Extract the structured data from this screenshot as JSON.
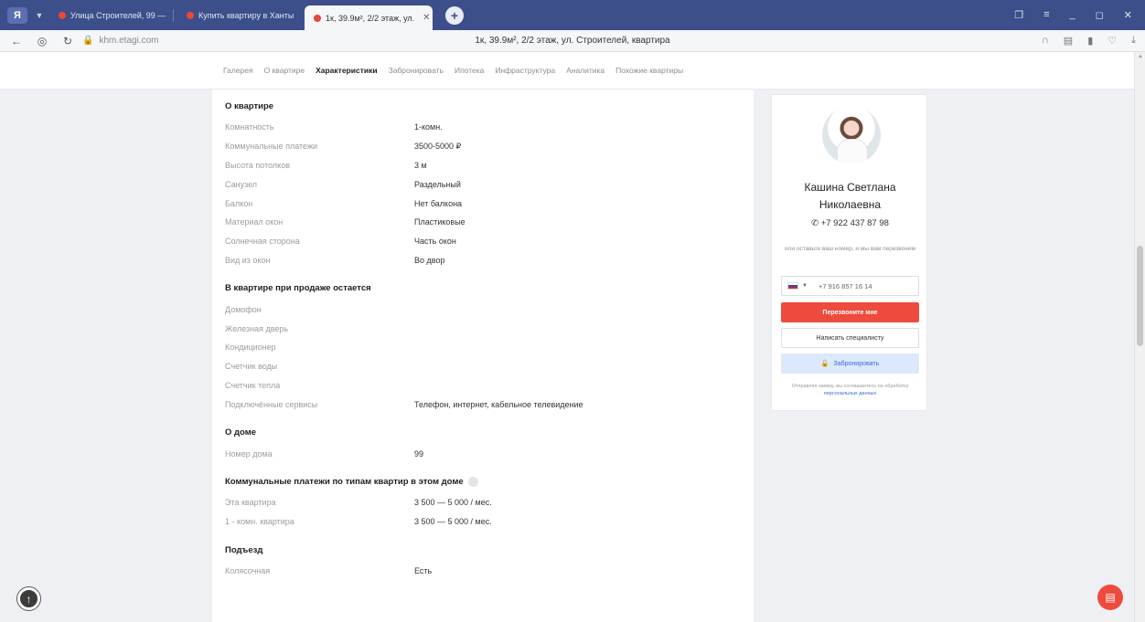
{
  "browser": {
    "tabs": [
      {
        "label": "Улица Строителей, 99 —"
      },
      {
        "label": "Купить квартиру в Ханты"
      },
      {
        "label": "1к, 39.9м², 2/2 этаж, ул."
      }
    ],
    "new_tab_icon": "+",
    "url": "khm.etagi.com",
    "page_title": "1к, 39.9м², 2/2 этаж, ул. Строителей, квартира"
  },
  "site_nav": {
    "items": [
      {
        "label": "Галерея"
      },
      {
        "label": "О квартире"
      },
      {
        "label": "Характеристики"
      },
      {
        "label": "Забронировать"
      },
      {
        "label": "Ипотека"
      },
      {
        "label": "Инфраструктура"
      },
      {
        "label": "Аналитика"
      },
      {
        "label": "Похожие квартиры"
      }
    ],
    "active_index": 2
  },
  "apartment": {
    "title": "О квартире",
    "rows": [
      {
        "k": "Комнатность",
        "v": "1-комн."
      },
      {
        "k": "Коммунальные платежи",
        "v": "3500-5000 ₽"
      },
      {
        "k": "Высота потолков",
        "v": "3 м"
      },
      {
        "k": "Санузел",
        "v": "Раздельный"
      },
      {
        "k": "Балкон",
        "v": "Нет балкона"
      },
      {
        "k": "Материал окон",
        "v": "Пластиковые"
      },
      {
        "k": "Солнечная сторона",
        "v": "Часть окон"
      },
      {
        "k": "Вид из окон",
        "v": "Во двор"
      }
    ]
  },
  "remains": {
    "title": "В квартире при продаже остается",
    "rows": [
      {
        "k": "Домофон",
        "v": ""
      },
      {
        "k": "Железная дверь",
        "v": ""
      },
      {
        "k": "Кондиционер",
        "v": ""
      },
      {
        "k": "Счетчик воды",
        "v": ""
      },
      {
        "k": "Счетчик тепла",
        "v": ""
      },
      {
        "k": "Подключённые сервисы",
        "v": "Телефон, интернет, кабельное телевидение"
      }
    ]
  },
  "house": {
    "title": "О доме",
    "rows": [
      {
        "k": "Номер дома",
        "v": "99"
      }
    ]
  },
  "utilities": {
    "title": "Коммунальные платежи по типам квартир в этом доме",
    "rows": [
      {
        "k": "Эта квартира",
        "v": "3 500 — 5 000 / мес."
      },
      {
        "k": "1 - комн. квартира",
        "v": "3 500 — 5 000 / мес."
      }
    ]
  },
  "entrance": {
    "title": "Подъезд",
    "rows": [
      {
        "k": "Колясочная",
        "v": "Есть"
      }
    ]
  },
  "agent": {
    "name": "Кашина Светлана Николаевна",
    "phone": "+7 922 437 87 98",
    "callback_hint": "или оставьте ваш номер, и мы вам перезвоним",
    "phone_input_value": "+7 916 857 16 14",
    "call_button": "Перезвоните мне",
    "write_button": "Написать специалисту",
    "book_button": "Забронировать",
    "consent_text": "Отправляя заявку, вы соглашаетесь на обработку",
    "consent_link": "персональных данных"
  }
}
